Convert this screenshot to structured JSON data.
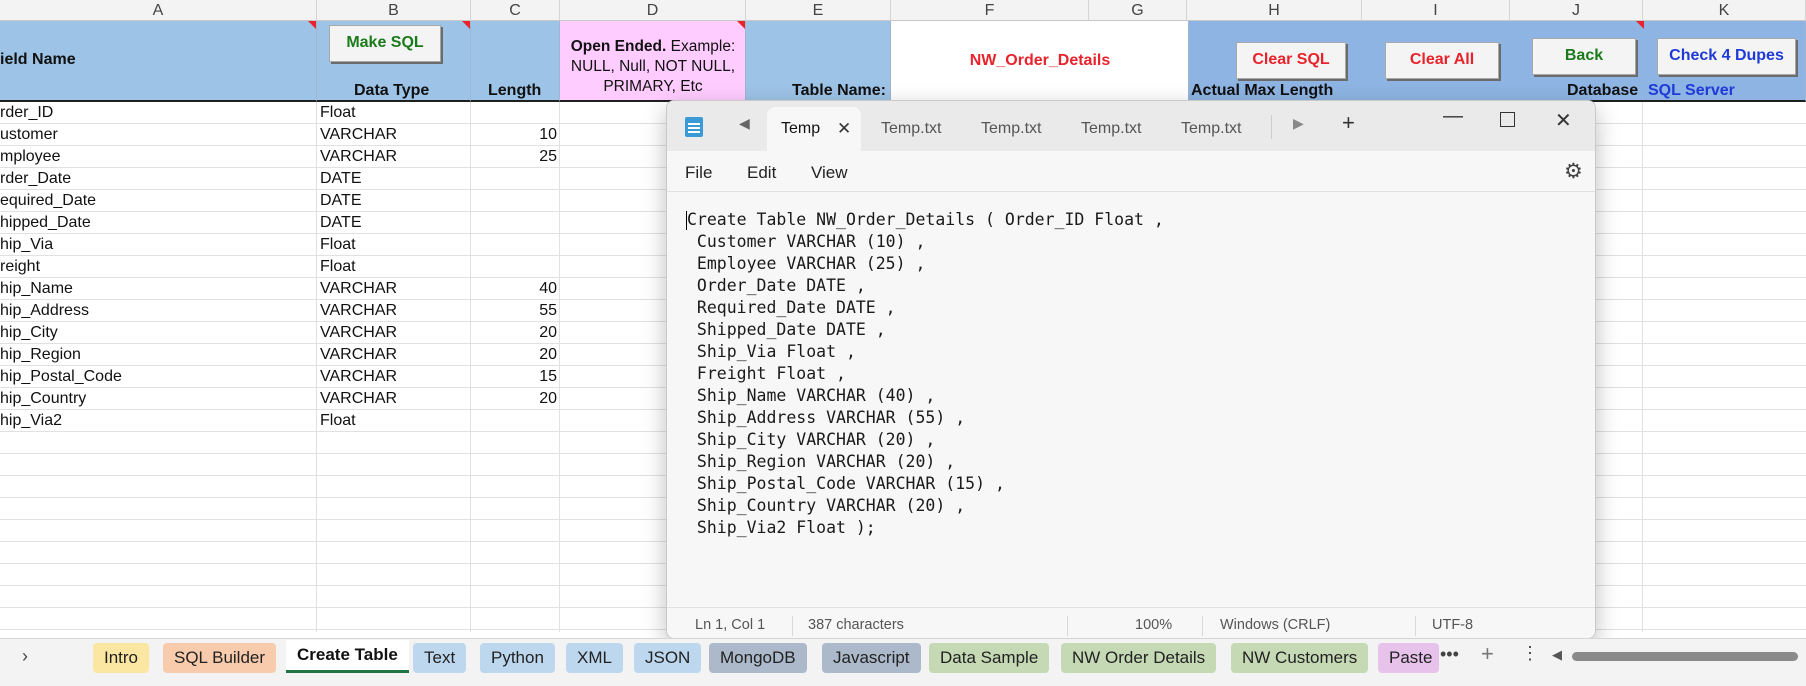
{
  "columns": {
    "a": "A",
    "b": "B",
    "c": "C",
    "d": "D",
    "e": "E",
    "f": "F",
    "g": "G",
    "h": "H",
    "i": "I",
    "j": "J",
    "k": "K"
  },
  "header": {
    "field_name": "ield Name",
    "make_sql": "Make SQL",
    "data_type": "Data Type",
    "length": "Length",
    "open_ended_bold": "Open Ended.",
    "open_ended_rest": " Example: NULL, Null, NOT NULL, PRIMARY, Etc",
    "table_name_label": "Table Name:",
    "table_name_value": "NW_Order_Details",
    "clear_sql": "Clear SQL",
    "clear_all": "Clear All",
    "back": "Back",
    "check_dupes": "Check 4 Dupes",
    "actual_max_length": "Actual Max Length",
    "database_label": "Database",
    "database_value": "SQL Server"
  },
  "rows": [
    {
      "name": "rder_ID",
      "type": "Float",
      "length": ""
    },
    {
      "name": "ustomer",
      "type": "VARCHAR",
      "length": "10"
    },
    {
      "name": "mployee",
      "type": "VARCHAR",
      "length": "25"
    },
    {
      "name": "rder_Date",
      "type": "DATE",
      "length": ""
    },
    {
      "name": "equired_Date",
      "type": "DATE",
      "length": ""
    },
    {
      "name": "hipped_Date",
      "type": "DATE",
      "length": ""
    },
    {
      "name": "hip_Via",
      "type": "Float",
      "length": ""
    },
    {
      "name": "reight",
      "type": "Float",
      "length": ""
    },
    {
      "name": "hip_Name",
      "type": "VARCHAR",
      "length": "40"
    },
    {
      "name": "hip_Address",
      "type": "VARCHAR",
      "length": "55"
    },
    {
      "name": "hip_City",
      "type": "VARCHAR",
      "length": "20"
    },
    {
      "name": "hip_Region",
      "type": "VARCHAR",
      "length": "20"
    },
    {
      "name": "hip_Postal_Code",
      "type": "VARCHAR",
      "length": "15"
    },
    {
      "name": "hip_Country",
      "type": "VARCHAR",
      "length": "20"
    },
    {
      "name": "hip_Via2",
      "type": "Float",
      "length": ""
    }
  ],
  "notepad": {
    "tabs": [
      "Temp",
      "Temp.txt",
      "Temp.txt",
      "Temp.txt",
      "Temp.txt"
    ],
    "menu": {
      "file": "File",
      "edit": "Edit",
      "view": "View"
    },
    "content": "Create Table NW_Order_Details ( Order_ID Float ,\n Customer VARCHAR (10) ,\n Employee VARCHAR (25) ,\n Order_Date DATE ,\n Required_Date DATE ,\n Shipped_Date DATE ,\n Ship_Via Float ,\n Freight Float ,\n Ship_Name VARCHAR (40) ,\n Ship_Address VARCHAR (55) ,\n Ship_City VARCHAR (20) ,\n Ship_Region VARCHAR (20) ,\n Ship_Postal_Code VARCHAR (15) ,\n Ship_Country VARCHAR (20) ,\n Ship_Via2 Float );",
    "status": {
      "position": "Ln 1, Col 1",
      "chars": "387 characters",
      "zoom": "100%",
      "eol": "Windows (CRLF)",
      "encoding": "UTF-8"
    }
  },
  "sheet_tabs": [
    {
      "label": "Intro",
      "color": "#fbe7a1"
    },
    {
      "label": "SQL Builder",
      "color": "#f8cbad"
    },
    {
      "label": "Create Table",
      "color": "#ffffff"
    },
    {
      "label": "Text",
      "color": "#bdd7ee"
    },
    {
      "label": "Python",
      "color": "#bdd7ee"
    },
    {
      "label": "XML",
      "color": "#bdd7ee"
    },
    {
      "label": "JSON",
      "color": "#bdd7ee"
    },
    {
      "label": "MongoDB",
      "color": "#acb9ca"
    },
    {
      "label": "Javascript",
      "color": "#acb9ca"
    },
    {
      "label": "Data Sample",
      "color": "#c5d9b5"
    },
    {
      "label": "NW Order Details",
      "color": "#c5d9b5"
    },
    {
      "label": "NW Customers",
      "color": "#c5d9b5"
    },
    {
      "label": "Paste",
      "color": "#e7c3ec"
    }
  ],
  "colors": {
    "header_blue": "#9dc3e6",
    "header_pink": "#ffccff",
    "header_dark_blue": "#8eb4e3",
    "red": "#e8232c",
    "green": "#1b7a1b",
    "blue": "#1f3ad8"
  }
}
